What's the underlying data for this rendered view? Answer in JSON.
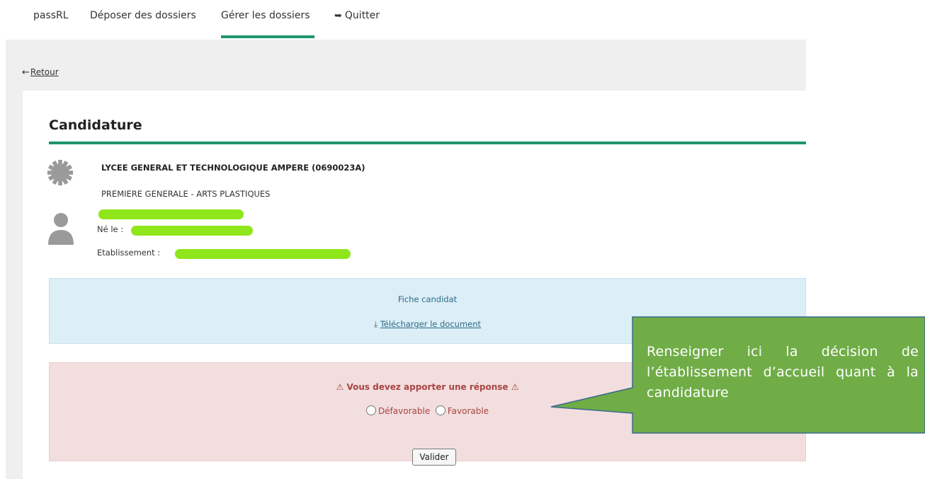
{
  "nav": {
    "brand": "passRL",
    "items": [
      {
        "label": "Déposer des dossiers"
      },
      {
        "label": "Gérer les dossiers",
        "active": true
      },
      {
        "label": "Quitter",
        "icon": "sign-out-icon"
      }
    ]
  },
  "back": {
    "label": "Retour",
    "icon": "arrow-left-icon"
  },
  "candidature": {
    "title": "Candidature",
    "school": "LYCEE GENERAL ET TECHNOLOGIQUE AMPERE (0690023A)",
    "formation": "PREMIERE GENERALE - ARTS PLASTIQUES",
    "born_label": "Né le :",
    "etab_label": "Etablissement :",
    "school_icon": "gear-icon",
    "person_icon": "user-icon"
  },
  "document": {
    "title": "Fiche candidat",
    "download_label": "Télécharger le document",
    "download_icon": "download-icon"
  },
  "decision": {
    "warning": "Vous devez apporter une réponse",
    "warning_icon": "warning-icon",
    "options": [
      "Défavorable",
      "Favorable"
    ],
    "submit_label": "Valider"
  },
  "callout": {
    "text": "Renseigner ici la décision de l’établissement d’accueil quant à la candidature"
  },
  "colors": {
    "accent": "#1f9470",
    "info_bg": "#dceef6",
    "alert_bg": "#f2dede",
    "alert_text": "#a94442",
    "callout_bg": "#70ad47",
    "highlight": "#8fe61a"
  }
}
